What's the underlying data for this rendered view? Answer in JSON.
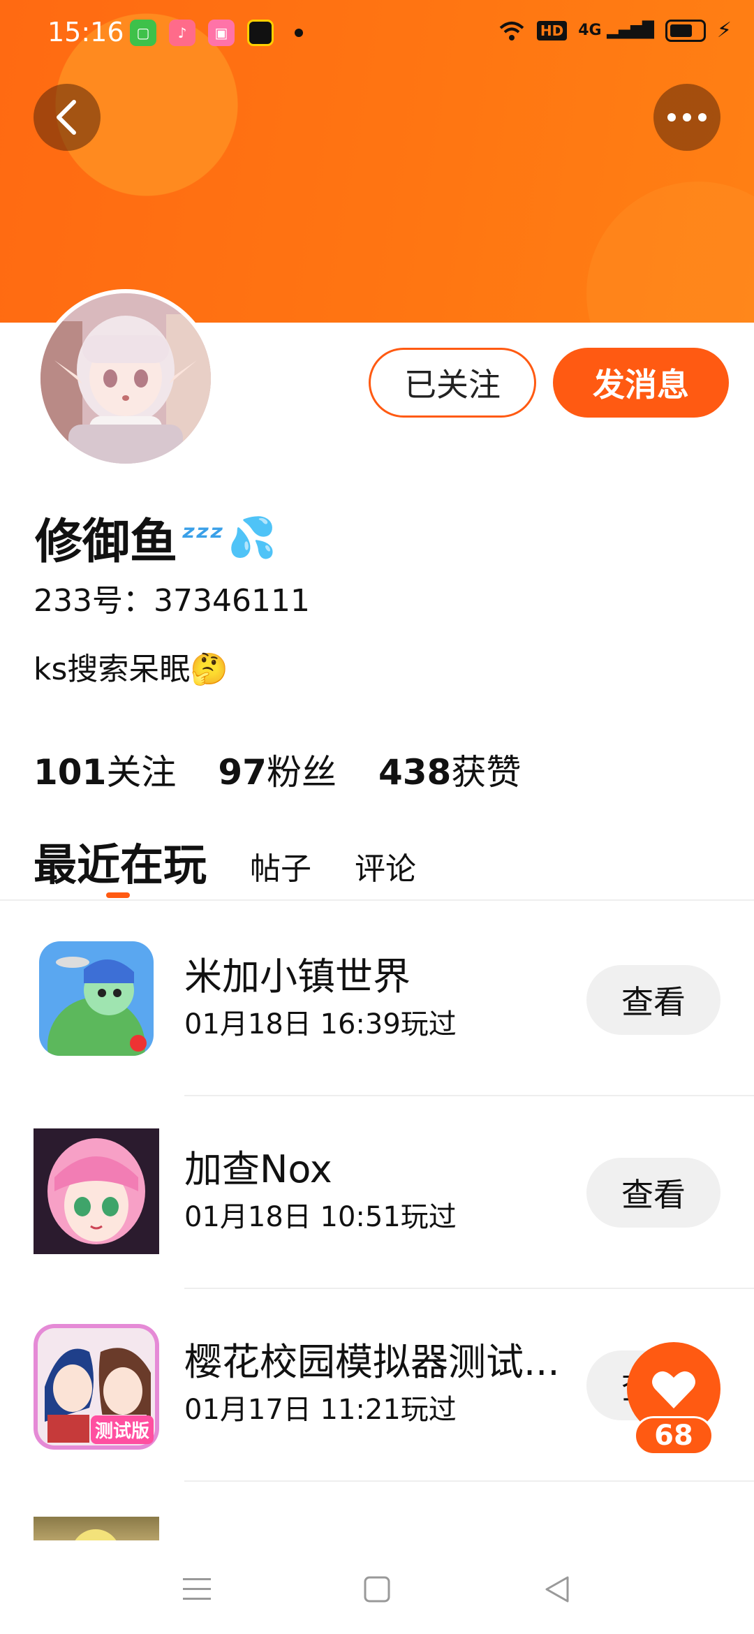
{
  "status_bar": {
    "time": "15:16",
    "apps": [
      "green-app-icon",
      "music-app-icon",
      "bilibili-icon",
      "black-app-icon"
    ],
    "network": "4G",
    "hd": "HD",
    "battery_level": 0.7
  },
  "profile": {
    "followed_label": "已关注",
    "message_label": "发消息",
    "username": "修御鱼",
    "username_emoji_zzz": "ᶻᶻᶻ",
    "username_emoji_drops": "💦",
    "uid": "233号：37346111",
    "bio": "ks搜索呆眠🤔"
  },
  "stats": [
    {
      "num": "101",
      "label": "关注"
    },
    {
      "num": "97",
      "label": "粉丝"
    },
    {
      "num": "438",
      "label": "获赞"
    }
  ],
  "tabs": {
    "active": "最近在玩",
    "posts": "帖子",
    "comments": "评论"
  },
  "games": [
    {
      "title": "米加小镇世界",
      "time": "01月18日 16:39玩过",
      "button": "查看"
    },
    {
      "title": "加查Nox",
      "time": "01月18日 10:51玩过",
      "button": "查看"
    },
    {
      "title": "樱花校园模拟器测试...",
      "time": "01月17日 11:21玩过",
      "button": "查看"
    }
  ],
  "game3_badge": "测试版",
  "like": {
    "count": "68"
  },
  "colors": {
    "accent": "#ff5a12",
    "banner": "#ff7512"
  }
}
